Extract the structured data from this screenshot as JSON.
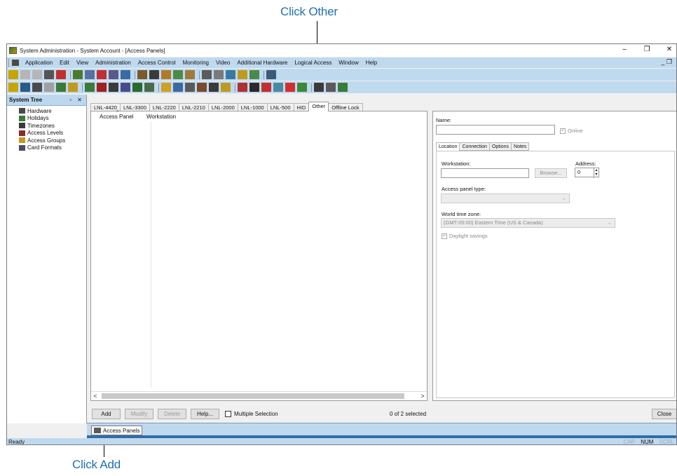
{
  "callouts": {
    "top": "Click Other",
    "bottom": "Click Add"
  },
  "window": {
    "title": "System Administration - System Account - [Access Panels]",
    "controls": [
      "–",
      "❐",
      "✕"
    ]
  },
  "menu": {
    "items": [
      "Application",
      "Edit",
      "View",
      "Administration",
      "Access Control",
      "Monitoring",
      "Video",
      "Additional Hardware",
      "Logical Access",
      "Window",
      "Help"
    ],
    "mdi_controls": "_ ❐"
  },
  "toolbar_icons": {
    "row1": [
      "#c8a400",
      "#b5b5b5",
      "#b5b5b5",
      "#555",
      "#c03030",
      "#4a7a2a",
      "#5a70a0",
      "#c03030",
      "#5a5a8a",
      "#3a6aa0",
      "#7a5a2a",
      "#3a3a3a",
      "#b07a2a",
      "#4a8a4a",
      "#a07a3a",
      "#5a5a5a",
      "#7a7a7a",
      "#3a7aa0",
      "#c09a20",
      "#4a8a4a",
      "#3a5a7a"
    ],
    "row2": [
      "#c8a400",
      "#2a5a8a",
      "#4a4a4a",
      "#a0a0a0",
      "#3a7a3a",
      "#c09a20",
      "#3a7a3a",
      "#a02020",
      "#3a3a3a",
      "#4a4a8a",
      "#2a6a2a",
      "#4a6a4a",
      "#d0a020",
      "#3a6aa0",
      "#5a5a5a",
      "#7a4a2a",
      "#3a3a3a",
      "#c09a20",
      "#b03030",
      "#2a2a2a",
      "#c03030",
      "#4a8aa0",
      "#d03030",
      "#3a8a3a",
      "#3a3a3a",
      "#5a5a5a",
      "#3a7a3a"
    ]
  },
  "system_tree": {
    "title": "System Tree",
    "header_controls": "▫ ✕",
    "items": [
      {
        "label": "Hardware",
        "icon": "hardware-icon",
        "color": "#4a4a4a"
      },
      {
        "label": "Holidays",
        "icon": "holidays-icon",
        "color": "#3a7a3a"
      },
      {
        "label": "Timezones",
        "icon": "timezones-icon",
        "color": "#3a3a3a"
      },
      {
        "label": "Access Levels",
        "icon": "access-levels-icon",
        "color": "#8a2a2a"
      },
      {
        "label": "Access Groups",
        "icon": "access-groups-icon",
        "color": "#c09a20"
      },
      {
        "label": "Card Formats",
        "icon": "card-formats-icon",
        "color": "#4a4a6a"
      }
    ]
  },
  "tabs": [
    "LNL-4420",
    "LNL-3300",
    "LNL-2220",
    "LNL-2210",
    "LNL-2000",
    "LNL-1000",
    "LNL-500",
    "HID",
    "Other",
    "Offline Lock"
  ],
  "active_tab": "Other",
  "list": {
    "columns": [
      "Access Panel",
      "Workstation"
    ],
    "sort_indicator": "^",
    "scroll_left": "<",
    "scroll_right": ">"
  },
  "properties": {
    "name_label": "Name:",
    "name_value": "",
    "online_label": "Online",
    "tabs": [
      "Location",
      "Connection",
      "Options",
      "Notes"
    ],
    "workstation_label": "Workstation:",
    "browse_label": "Browse...",
    "address_label": "Address:",
    "address_value": "0",
    "panel_type_label": "Access panel type:",
    "world_time_label": "World time zone:",
    "world_time_value": "(GMT-05:00) Eastern Time (US & Canada)",
    "daylight_label": "Daylight savings"
  },
  "buttons": {
    "add": "Add",
    "modify": "Modify",
    "delete": "Delete",
    "help": "Help...",
    "multiple_selection": "Multiple Selection",
    "close": "Close"
  },
  "selection_count": "0 of 2 selected",
  "window_tab": "Access Panels",
  "status": {
    "text": "Ready",
    "keys": [
      "CAP",
      "NUM",
      "SCRL"
    ]
  }
}
